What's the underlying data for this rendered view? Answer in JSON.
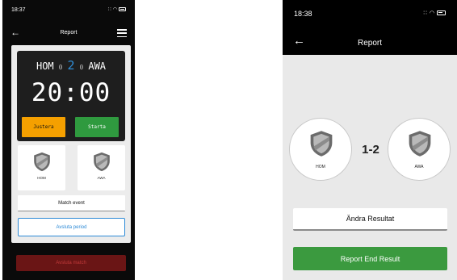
{
  "left": {
    "status": {
      "time": "18:37",
      "signal": "∷",
      "wifi": "◠"
    },
    "nav": {
      "title": "Report"
    },
    "score": {
      "home_team": "HOM",
      "home_score": "0",
      "period": "2",
      "away_score": "0",
      "away_team": "AWA",
      "clock": "20:00"
    },
    "buttons": {
      "justera": "Justera",
      "starta": "Starta",
      "match_event": "Match event",
      "avsluta_period": "Avsluta period",
      "avsluta_match": "Avsluta match"
    },
    "teams": {
      "home": "HOM",
      "away": "AWA"
    }
  },
  "right": {
    "status": {
      "time": "18:38",
      "signal": "∷",
      "wifi": "◠"
    },
    "nav": {
      "title": "Report"
    },
    "result": "1-2",
    "teams": {
      "home": "HOM",
      "away": "AWA"
    },
    "buttons": {
      "andra_resultat": "Ändra Resultat",
      "report_end_result": "Report End Result"
    }
  },
  "colors": {
    "accent_blue": "#2d8ad6",
    "orange": "#f5a000",
    "green": "#2f9a3f",
    "dark_red": "#6a1515"
  },
  "icons": [
    "back-arrow-icon",
    "menu-icon",
    "shield-icon",
    "battery-icon",
    "wifi-icon",
    "signal-icon"
  ]
}
